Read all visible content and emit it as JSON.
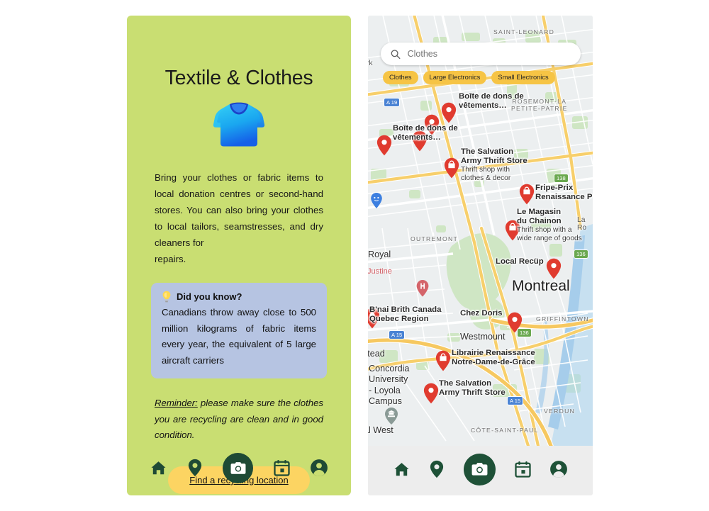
{
  "left_panel": {
    "title": "Textile & Clothes",
    "hero_icon": "tshirt-icon",
    "body_lines": [
      "Bring your clothes or fabric items to local",
      "donation centres or second-hand stores.",
      "You can also bring your clothes to local",
      "tailors, seamstresses, and dry cleaners for",
      "repairs."
    ],
    "fact_card": {
      "icon": "lightbulb-icon",
      "heading": "Did you know?",
      "text": "Canadians throw away close to 500 million kilograms of fabric items every year, the equivalent of 5 large aircraft carriers"
    },
    "reminder": {
      "lead": "Reminder:",
      "text": " please make sure the clothes you are recycling are clean and in good condition."
    },
    "cta_label": "Find a recycling location",
    "bg_color": "#c9de72",
    "card_color": "#b6c4e2",
    "cta_color": "#fcd462"
  },
  "bottom_nav": {
    "items": [
      {
        "name": "home",
        "label": "Home"
      },
      {
        "name": "location",
        "label": "Map"
      },
      {
        "name": "camera",
        "label": "Scan"
      },
      {
        "name": "calendar",
        "label": "Calendar"
      },
      {
        "name": "profile",
        "label": "Profile"
      }
    ],
    "active": "camera",
    "accent_color": "#1e4a35"
  },
  "map_panel": {
    "search": {
      "value": "",
      "placeholder": "Clothes"
    },
    "chips": [
      {
        "label": "Clothes",
        "selected": true
      },
      {
        "label": "Large Electronics",
        "selected": false
      },
      {
        "label": "Small Electronics",
        "selected": false
      }
    ],
    "chip_color": "#f6c445",
    "pin_color": "#e03b2f",
    "labels": {
      "saint_leonard": "SAINT-LEONARD",
      "rosemont": "ROSEMONT-LA",
      "rosemont2": "PETITE-PATRIE",
      "outremont": "OUTREMONT",
      "griffintown": "GRIFFINTOWN",
      "verdun": "VERDUN",
      "cote_saint_paul": "CÔTE-SAINT-PAUL",
      "montreal": "Montreal",
      "westmount": "Westmount",
      "la_ro": "La Ro",
      "royal": "Royal",
      "sainte_justine": "nte-Justine",
      "hostead": "ostead",
      "al_west": "al West",
      "rk": "rk",
      "concordia": [
        "Concordia",
        "University",
        "- Loyola",
        "Campus"
      ]
    },
    "pois": [
      {
        "name": "Boîte de dons de vêtements…",
        "lines": [
          "Boîte de dons de",
          "vêtements…"
        ],
        "sub": null
      },
      {
        "name": "Boîte de dons de vêtements…",
        "lines": [
          "Boîte de dons de",
          "vêtements…"
        ],
        "sub": null
      },
      {
        "name": "The Salvation Army Thrift Store",
        "lines": [
          "The Salvation",
          "Army Thrift Store"
        ],
        "sub": [
          "Thrift shop with",
          "clothes & decor"
        ]
      },
      {
        "name": "Fripe-Prix Renaissance P",
        "lines": [
          "Fripe-Prix",
          "Renaissance P"
        ],
        "sub": null
      },
      {
        "name": "Le Magasin du Chainon",
        "lines": [
          "Le Magasin",
          "du Chainon"
        ],
        "sub": [
          "Thrift shop with a",
          "wide range of goods"
        ]
      },
      {
        "name": "Local Recüp",
        "lines": [
          "Local Recüp"
        ],
        "sub": null
      },
      {
        "name": "Chez Doris",
        "lines": [
          "Chez Doris"
        ],
        "sub": null
      },
      {
        "name": "B'nai Brith Canada Quebec Region",
        "lines": [
          "B'nai Brith Canada",
          "Quebec Region"
        ],
        "sub": null
      },
      {
        "name": "Librairie Renaissance Notre-Dame-de-Grâce",
        "lines": [
          "Librairie Renaissance",
          "Notre-Dame-de-Grâce"
        ],
        "sub": null
      },
      {
        "name": "The Salvation Army Thrift Store",
        "lines": [
          "The Salvation",
          "Army Thrift Store"
        ],
        "sub": null
      }
    ],
    "route_shields": [
      "A 19",
      "138",
      "136",
      "A 15",
      "136",
      "A 15"
    ]
  }
}
